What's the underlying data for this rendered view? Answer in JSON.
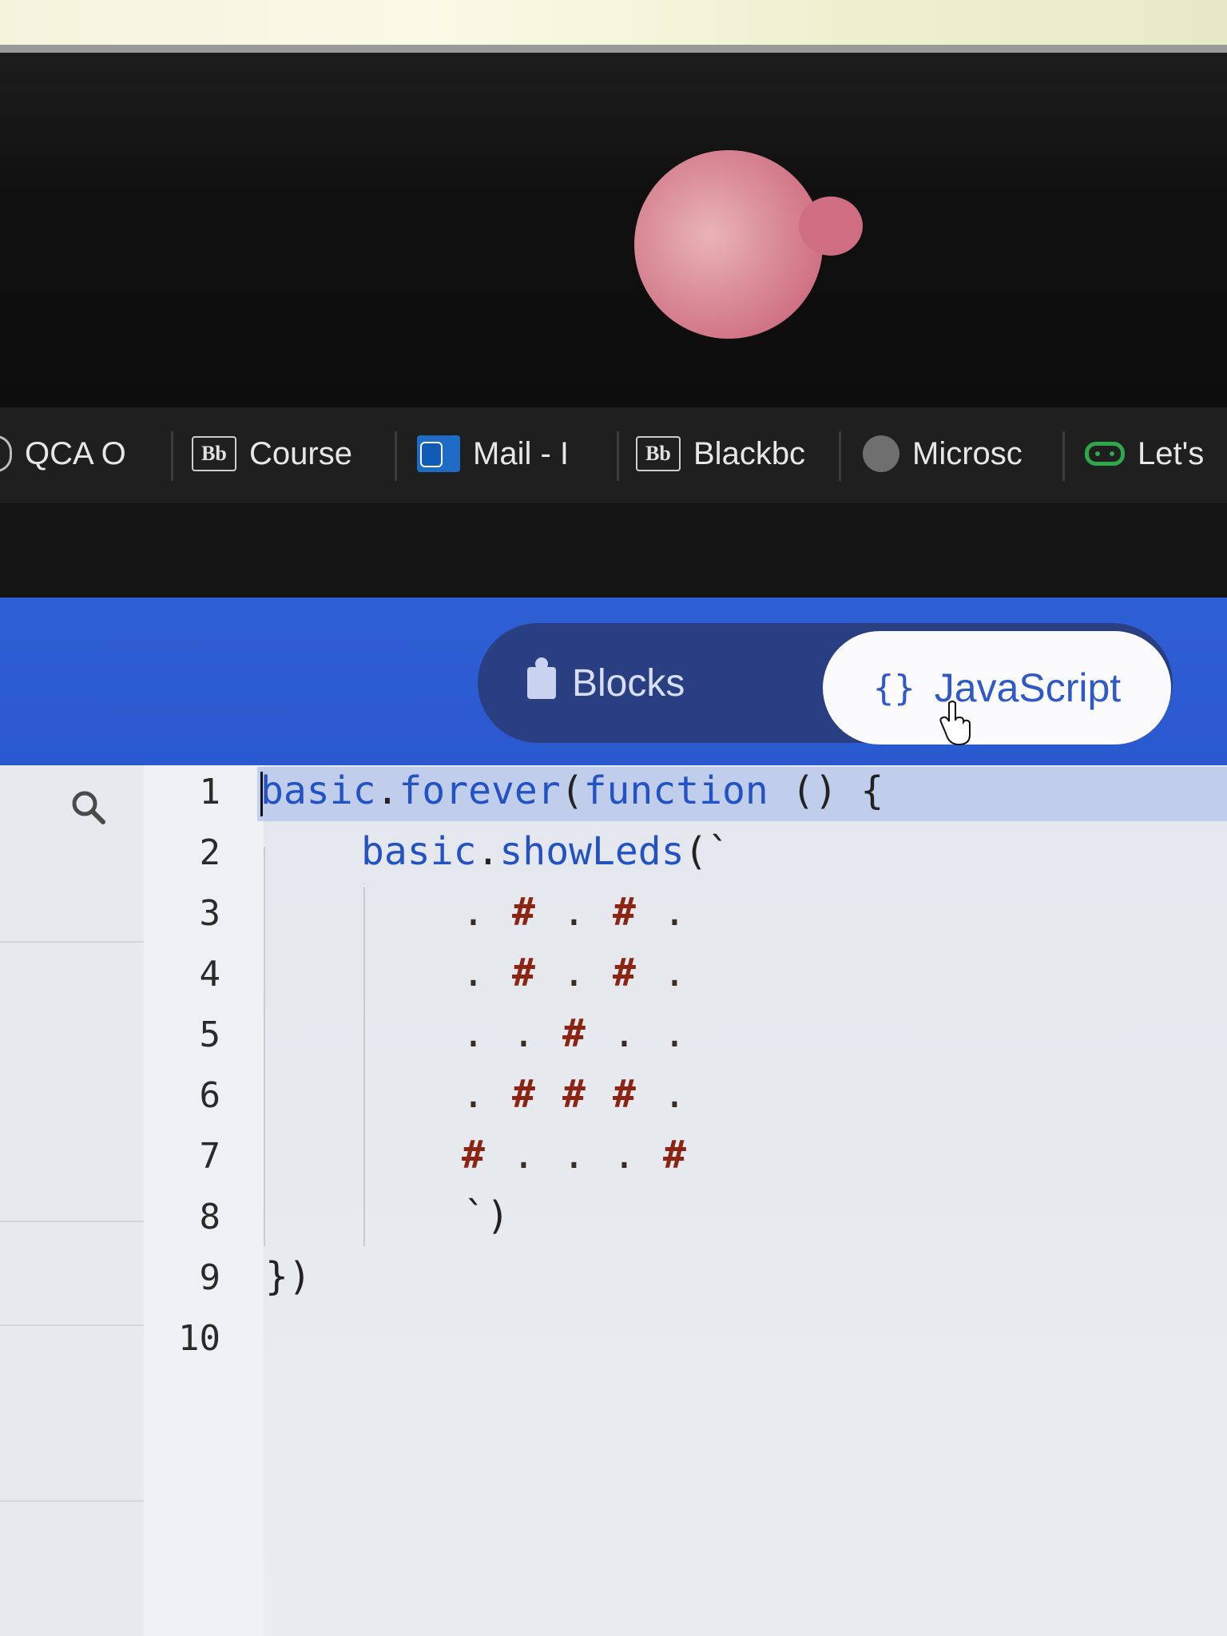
{
  "bookmarks": [
    {
      "label": "QCA O",
      "icon": "circle-icon"
    },
    {
      "label": "Course",
      "icon": "blackboard-icon"
    },
    {
      "label": "Mail - I",
      "icon": "outlook-icon"
    },
    {
      "label": "Blackbc",
      "icon": "blackboard-icon"
    },
    {
      "label": "Microsc",
      "icon": "globe-icon"
    },
    {
      "label": "Let's",
      "icon": "microbit-icon"
    }
  ],
  "bb_icon_text": "Bb",
  "header": {
    "blocks_label": "Blocks",
    "javascript_label": "JavaScript",
    "braces": "{}",
    "active_mode": "JavaScript"
  },
  "editor": {
    "line_numbers": [
      "1",
      "2",
      "3",
      "4",
      "5",
      "6",
      "7",
      "8",
      "9",
      "10"
    ],
    "lines": {
      "l1_obj": "basic",
      "l1_dot": ".",
      "l1_method": "forever",
      "l1_paren": "(",
      "l1_kw": "function",
      "l1_rest": " () {",
      "l2_obj": "basic",
      "l2_dot": ".",
      "l2_method": "showLeds",
      "l2_rest": "(`",
      "l8": "`)",
      "l9": "})"
    },
    "led_rows": [
      [
        ".",
        "#",
        ".",
        "#",
        "."
      ],
      [
        ".",
        "#",
        ".",
        "#",
        "."
      ],
      [
        ".",
        ".",
        "#",
        ".",
        "."
      ],
      [
        ".",
        "#",
        "#",
        "#",
        "."
      ],
      [
        "#",
        ".",
        ".",
        ".",
        "#"
      ]
    ]
  }
}
